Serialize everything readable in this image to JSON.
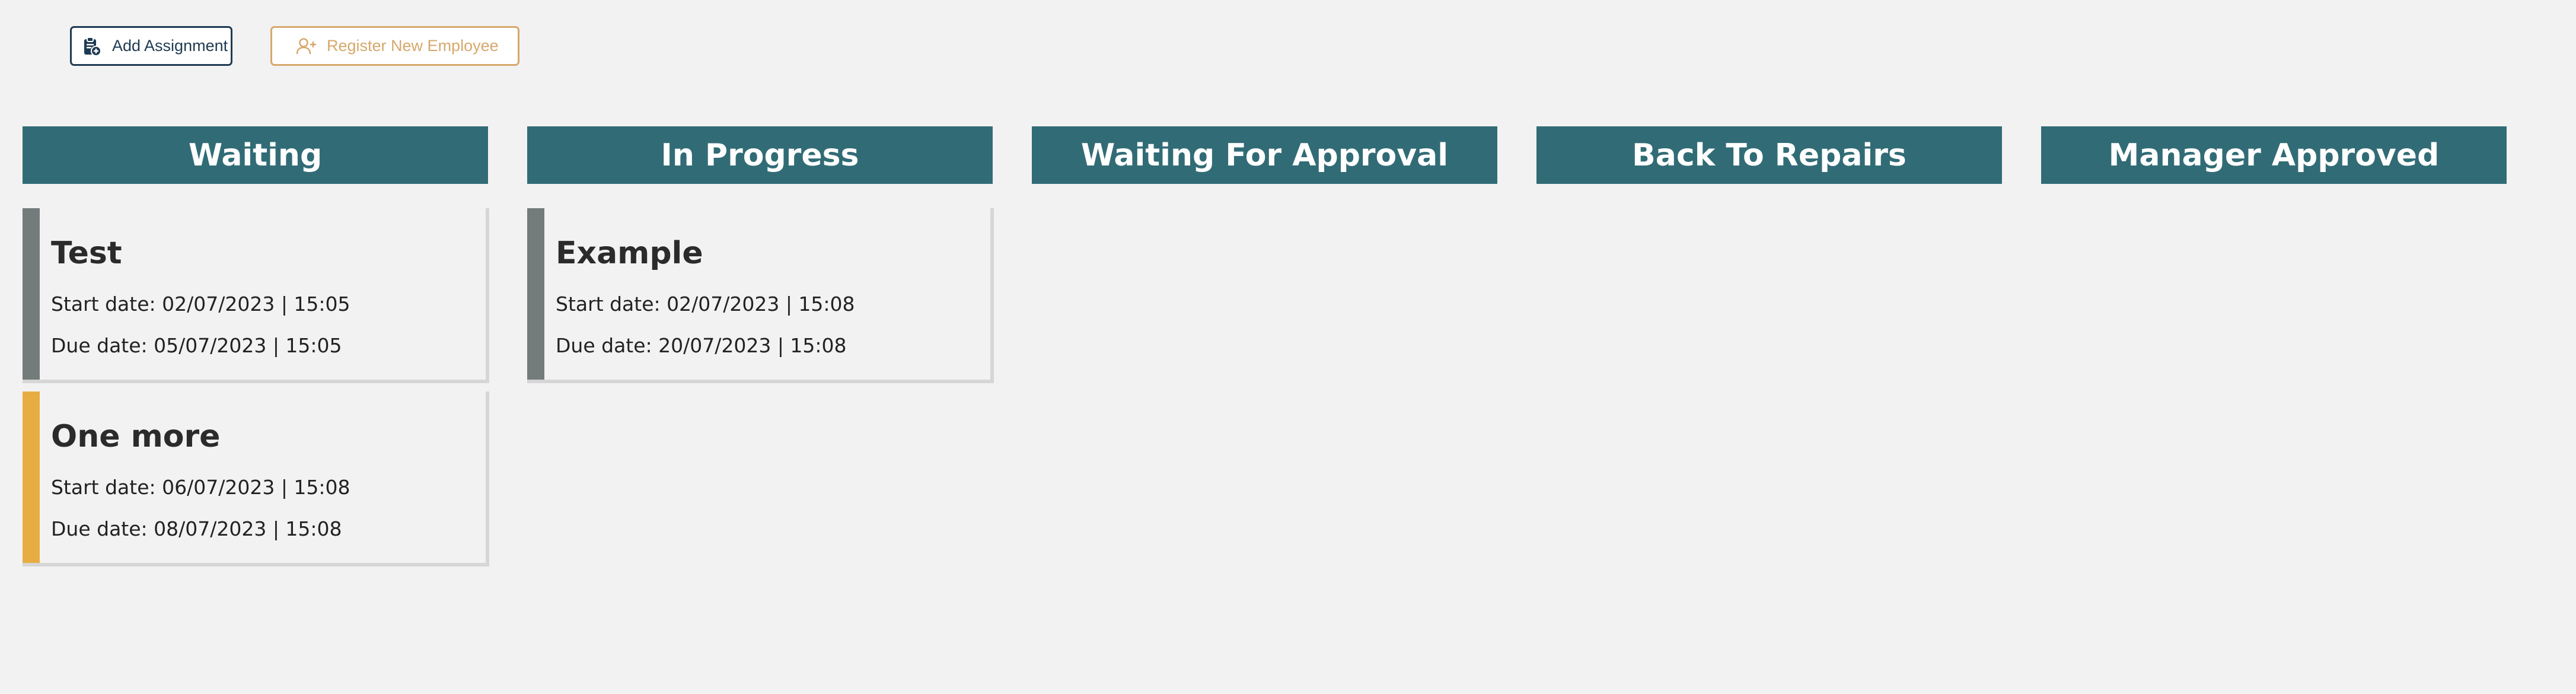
{
  "toolbar": {
    "add_assignment": {
      "label": "Add Assignment",
      "icon": "clipboard-plus-icon",
      "color": "#1f3a52"
    },
    "register_employee": {
      "label": "Register New Employee",
      "icon": "user-plus-icon",
      "color": "#d6a86b"
    }
  },
  "colors": {
    "header_bg": "#316c76",
    "priority_gray": "#737b7b",
    "priority_yellow": "#e8ad42"
  },
  "columns": [
    {
      "title": "Waiting",
      "cards": [
        {
          "title": "Test",
          "start": "Start date: 02/07/2023 | 15:05",
          "due": "Due date: 05/07/2023 | 15:05",
          "color": "#737b7b"
        },
        {
          "title": "One more",
          "start": "Start date: 06/07/2023 | 15:08",
          "due": "Due date: 08/07/2023 | 15:08",
          "color": "#e8ad42"
        }
      ]
    },
    {
      "title": "In Progress",
      "cards": [
        {
          "title": "Example",
          "start": "Start date: 02/07/2023 | 15:08",
          "due": "Due date: 20/07/2023 | 15:08",
          "color": "#737b7b"
        }
      ]
    },
    {
      "title": "Waiting For Approval",
      "cards": []
    },
    {
      "title": "Back To Repairs",
      "cards": []
    },
    {
      "title": "Manager Approved",
      "cards": []
    }
  ]
}
